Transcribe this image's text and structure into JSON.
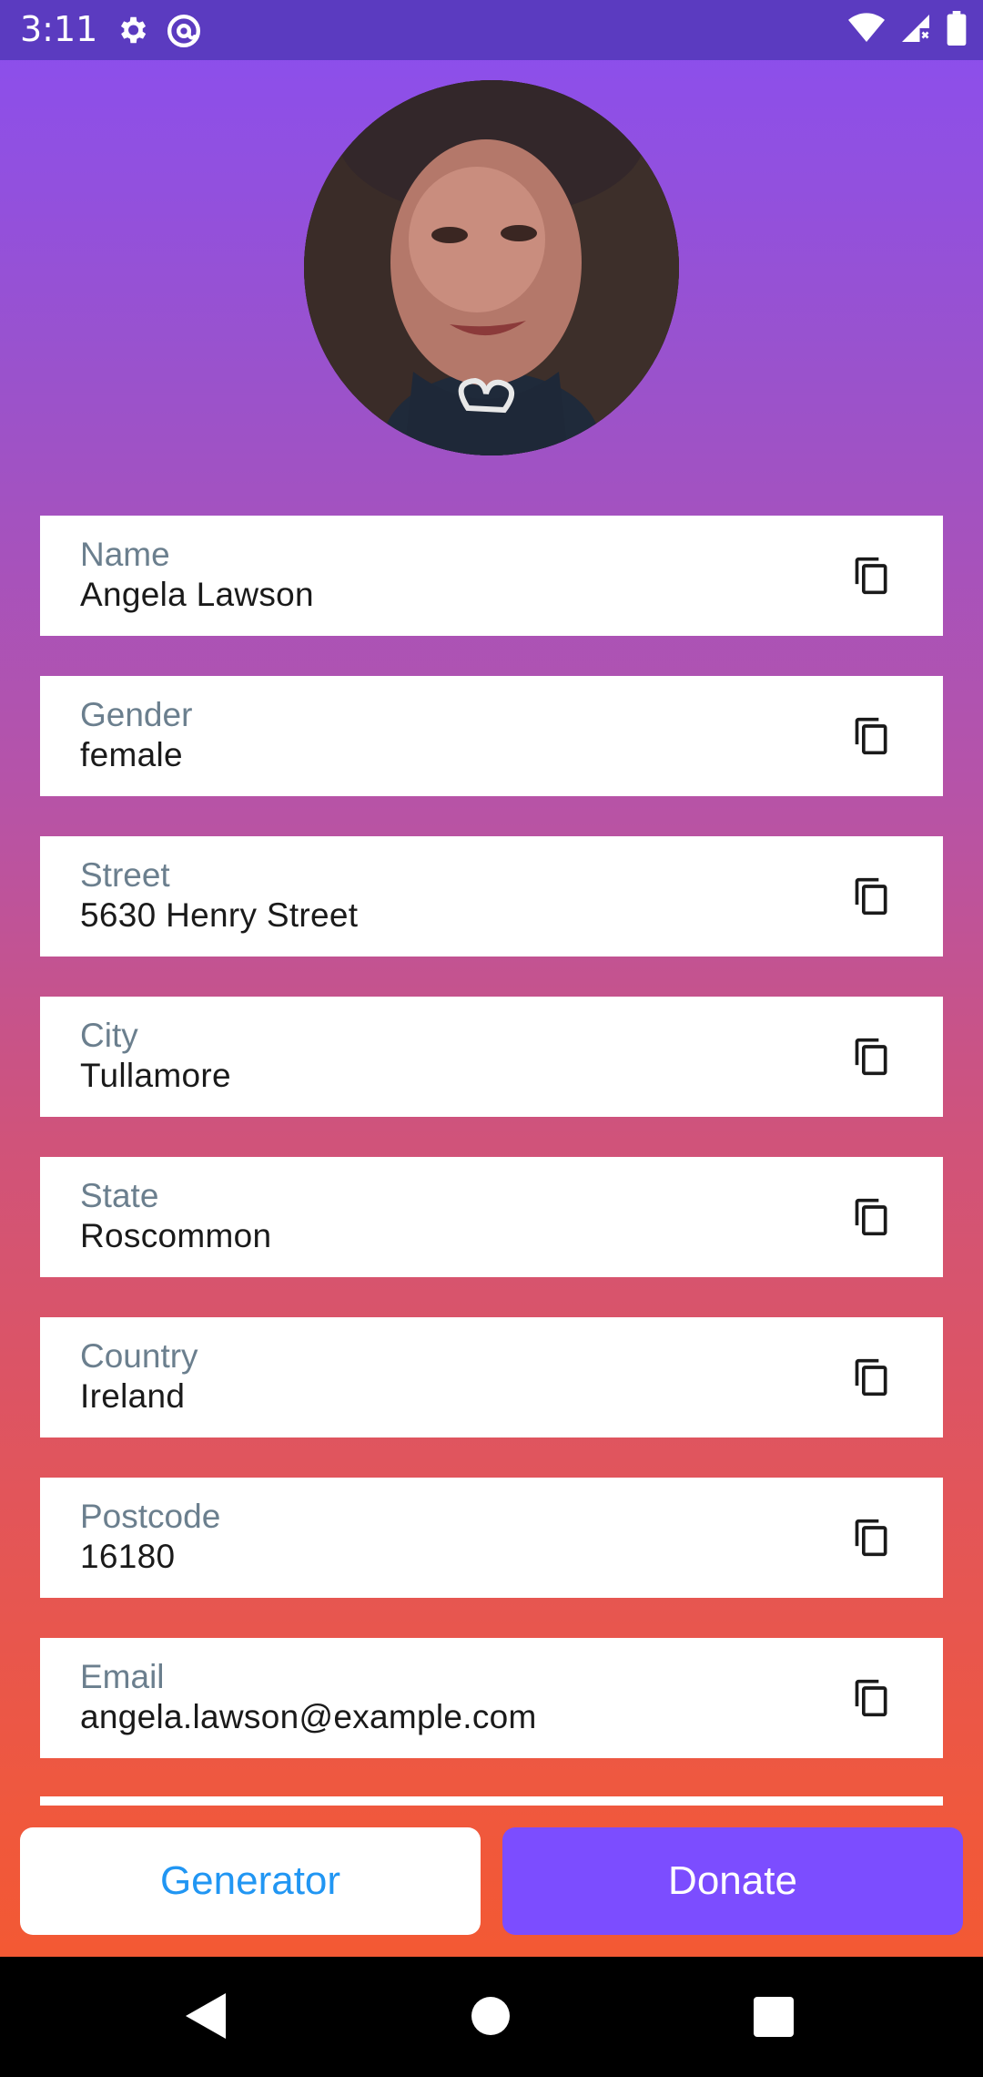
{
  "status_bar": {
    "time": "3:11",
    "icons": [
      "settings-icon",
      "at-sign-icon",
      "wifi-icon",
      "signal-icon",
      "battery-icon"
    ]
  },
  "profile": {
    "avatar": "profile-photo"
  },
  "fields": [
    {
      "label": "Name",
      "value": "Angela Lawson"
    },
    {
      "label": "Gender",
      "value": "female"
    },
    {
      "label": "Street",
      "value": "5630 Henry Street"
    },
    {
      "label": "City",
      "value": "Tullamore"
    },
    {
      "label": "State",
      "value": "Roscommon"
    },
    {
      "label": "Country",
      "value": "Ireland"
    },
    {
      "label": "Postcode",
      "value": "16180"
    },
    {
      "label": "Email",
      "value": "angela.lawson@example.com"
    }
  ],
  "buttons": {
    "generator": "Generator",
    "donate": "Donate"
  },
  "colors": {
    "status_bar": "#5b3bc0",
    "gradient_top": "#8a4ef0",
    "gradient_bottom": "#f65a2c",
    "generator_text": "#2196f3",
    "donate_bg": "#7c4dff"
  }
}
